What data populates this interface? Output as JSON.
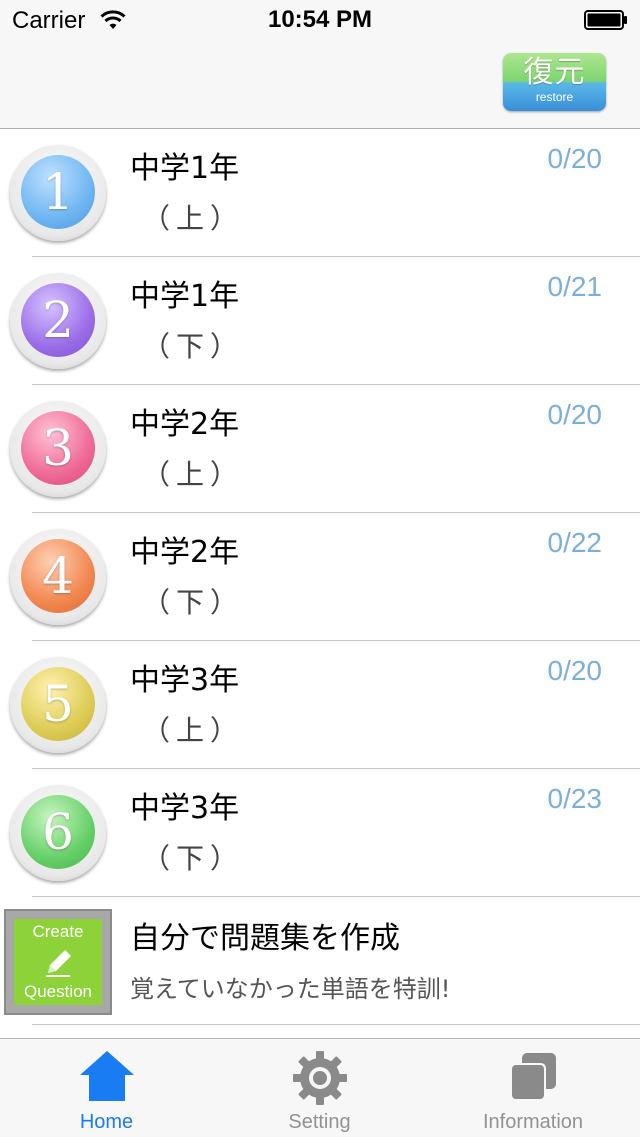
{
  "status_bar": {
    "carrier": "Carrier",
    "time": "10:54 PM"
  },
  "nav": {
    "restore_kanji": "復元",
    "restore_label": "restore"
  },
  "items": [
    {
      "number": "1",
      "title": "中学1年",
      "sub": "（上）",
      "count": "0/20",
      "color": "#6fb6f2"
    },
    {
      "number": "2",
      "title": "中学1年",
      "sub": "（下）",
      "count": "0/21",
      "color": "#9b6ee8"
    },
    {
      "number": "3",
      "title": "中学2年",
      "sub": "（上）",
      "count": "0/20",
      "color": "#ef6a96"
    },
    {
      "number": "4",
      "title": "中学2年",
      "sub": "（下）",
      "count": "0/22",
      "color": "#f28750"
    },
    {
      "number": "5",
      "title": "中学3年",
      "sub": "（上）",
      "count": "0/20",
      "color": "#ddcc55"
    },
    {
      "number": "6",
      "title": "中学3年",
      "sub": "（下）",
      "count": "0/23",
      "color": "#66d068"
    }
  ],
  "create": {
    "icon_line1": "Create",
    "icon_line2": "Question",
    "title": "自分で問題集を作成",
    "subtitle": "覚えていなかった単語を特訓!"
  },
  "tabs": [
    {
      "label": "Home",
      "icon": "home-icon",
      "active": true
    },
    {
      "label": "Setting",
      "icon": "gear-icon",
      "active": false
    },
    {
      "label": "Information",
      "icon": "copy-icon",
      "active": false
    }
  ],
  "colors": {
    "accent": "#1a7cf2",
    "count": "#7ab0d8",
    "inactive_tab": "#929292"
  }
}
